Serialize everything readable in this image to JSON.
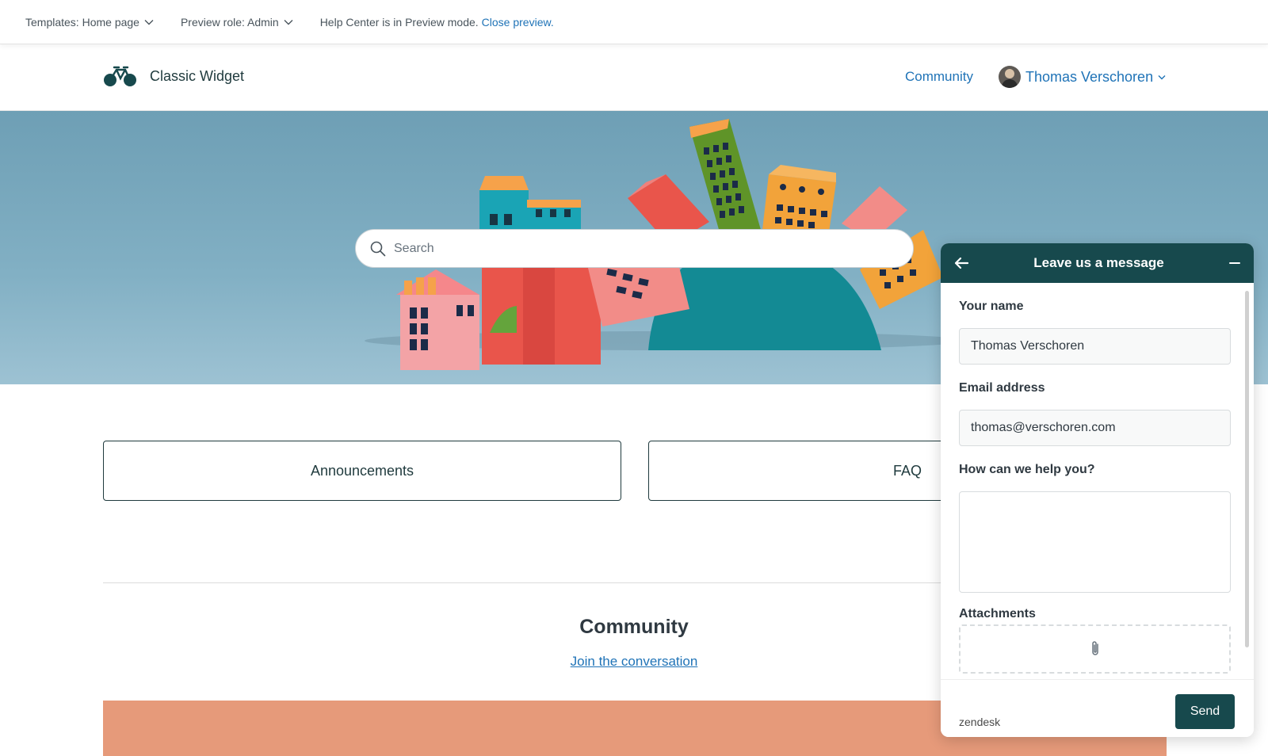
{
  "preview_bar": {
    "template_label": "Templates: Home page",
    "role_label": "Preview role: Admin",
    "mode_text": "Help Center is in Preview mode.",
    "close_link": "Close preview."
  },
  "header": {
    "brand_name": "Classic Widget",
    "nav_community": "Community",
    "user_name": "Thomas Verschoren"
  },
  "hero": {
    "search_placeholder": "Search"
  },
  "categories": [
    {
      "label": "Announcements"
    },
    {
      "label": "FAQ"
    }
  ],
  "community": {
    "title": "Community",
    "link": "Join the conversation"
  },
  "widget": {
    "title": "Leave us a message",
    "name_label": "Your name",
    "name_value": "Thomas Verschoren",
    "email_label": "Email address",
    "email_value": "thomas@verschoren.com",
    "help_label": "How can we help you?",
    "help_value": "",
    "attachments_label": "Attachments",
    "brand": "zendesk",
    "send_label": "Send"
  },
  "colors": {
    "accent": "#17494d",
    "link": "#1f73b7",
    "hero_sky": "#7fadc1"
  },
  "icons": {
    "logo": "bicycle-logo",
    "search": "search-icon",
    "back": "arrow-left-icon",
    "minimize": "minimize-icon",
    "attach": "paperclip-icon"
  }
}
